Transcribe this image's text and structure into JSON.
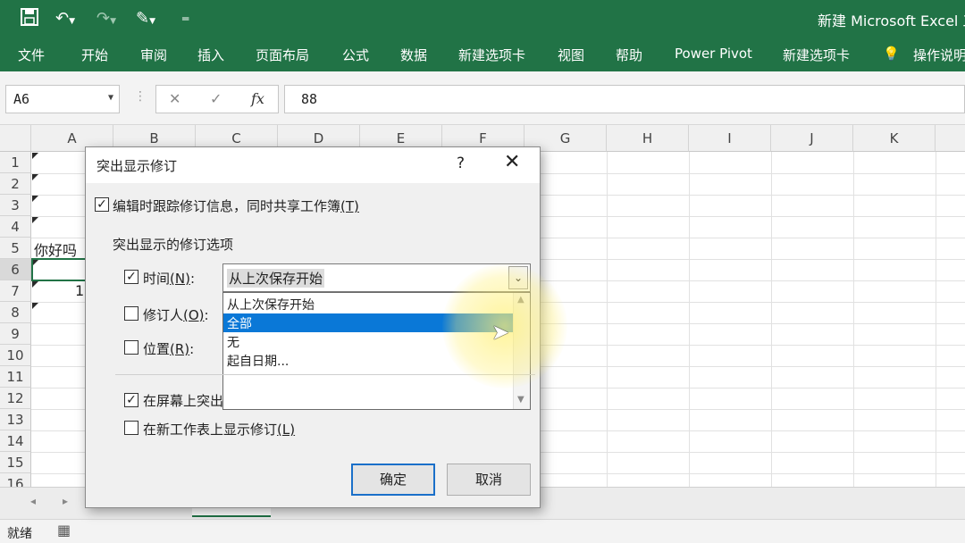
{
  "window": {
    "title": "新建 Microsoft Excel 工"
  },
  "ribbon": {
    "tabs": [
      "文件",
      "开始",
      "审阅",
      "插入",
      "页面布局",
      "公式",
      "数据",
      "新建选项卡",
      "视图",
      "帮助",
      "Power Pivot",
      "新建选项卡",
      "操作说明"
    ]
  },
  "formula_bar": {
    "name_box": "A6",
    "cancel_symbol": "✕",
    "enter_symbol": "✓",
    "fx_symbol": "fx",
    "value": "88"
  },
  "grid": {
    "columns": [
      "A",
      "B",
      "C",
      "D",
      "E",
      "F",
      "G",
      "H",
      "I",
      "J",
      "K"
    ],
    "rows": [
      "1",
      "2",
      "3",
      "4",
      "5",
      "6",
      "7",
      "8",
      "9",
      "10",
      "11",
      "12",
      "13",
      "14",
      "15",
      "16"
    ],
    "cells": {
      "A5": "你好吗",
      "A7": "1"
    }
  },
  "dialog": {
    "title": "突出显示修订",
    "help": "?",
    "close": "✕",
    "track_changes": {
      "checked": true,
      "label": "编辑时跟踪修订信息，同时共享工作簿",
      "key": "(T)"
    },
    "section_label": "突出显示的修订选项",
    "when": {
      "checked": true,
      "label": "时间",
      "key": "(N)",
      "colon": ":"
    },
    "who": {
      "checked": false,
      "label": "修订人",
      "key": "(O)",
      "colon": ":"
    },
    "where": {
      "checked": false,
      "label": "位置",
      "key": "(R)",
      "colon": ":"
    },
    "when_value": "从上次保存开始",
    "when_options": [
      "从上次保存开始",
      "全部",
      "无",
      "起自日期..."
    ],
    "when_selected_index": 1,
    "on_screen": {
      "checked": true,
      "label": "在屏幕上突出"
    },
    "new_sheet": {
      "checked": false,
      "label": "在新工作表上显示修订",
      "key": "(L)"
    },
    "ok": "确定",
    "cancel": "取消"
  },
  "status": {
    "ready": "就绪"
  },
  "colors": {
    "excel_green": "#217346",
    "selection_blue": "#0a78d7"
  }
}
